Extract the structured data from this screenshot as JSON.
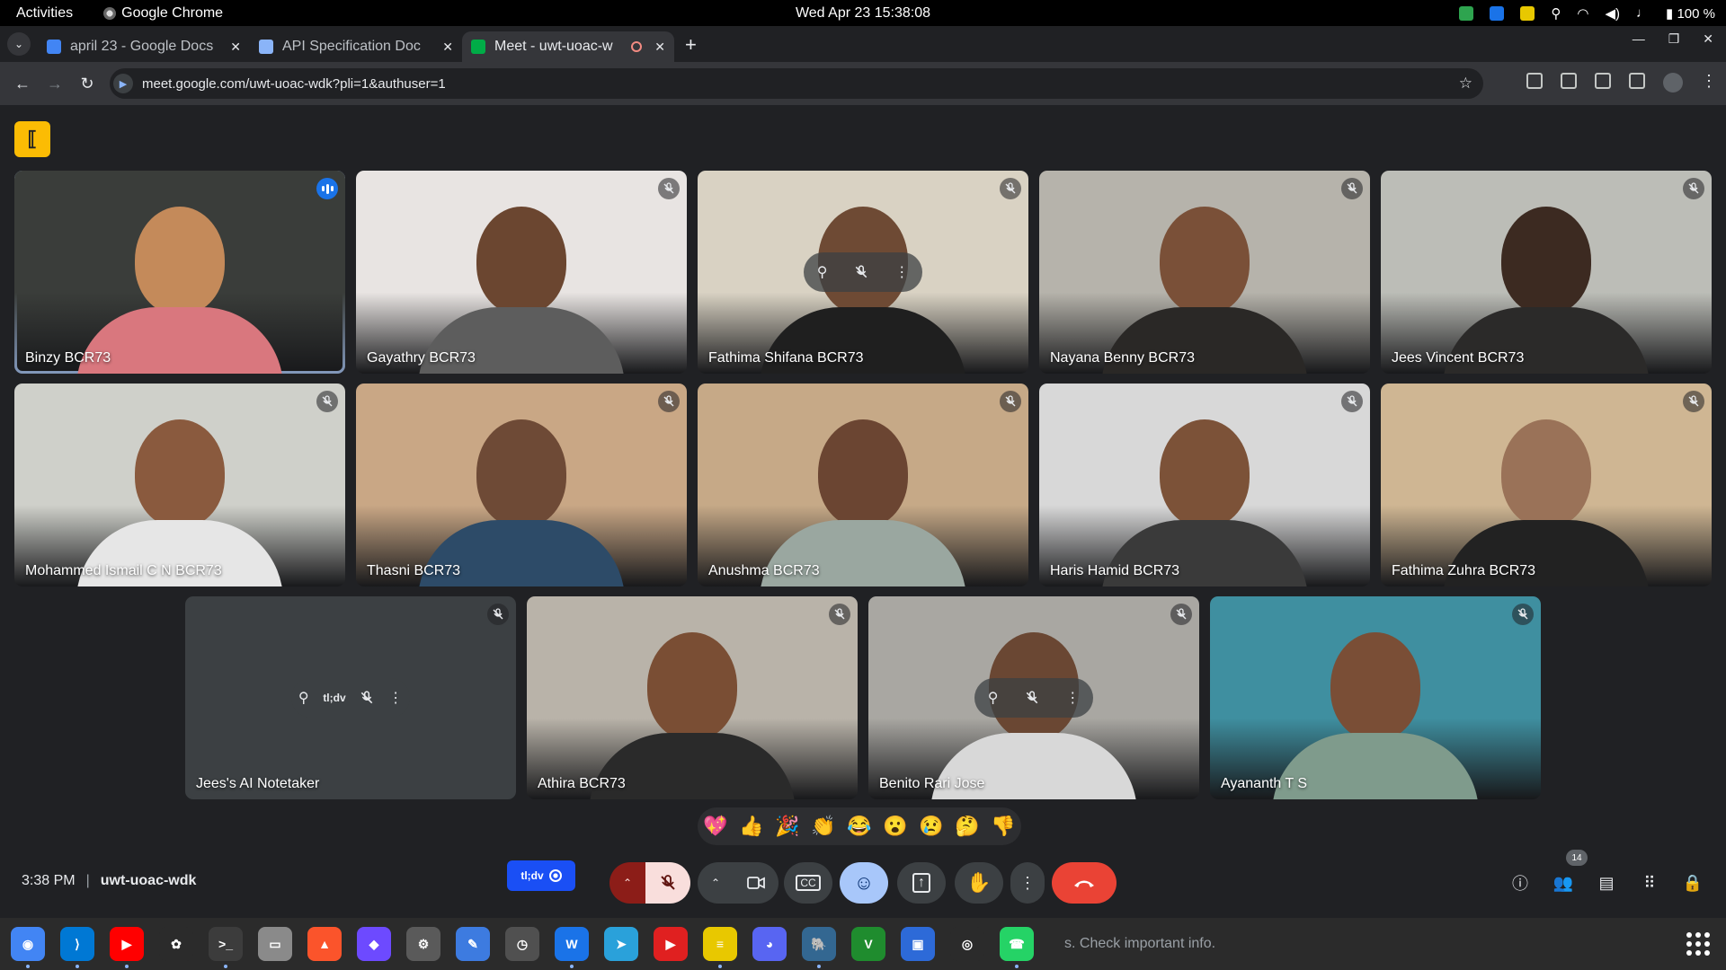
{
  "topbar": {
    "activities": "Activities",
    "app_name": "Google Chrome",
    "datetime": "Wed Apr 23  15:38:08",
    "battery": "100 %"
  },
  "tabs": [
    {
      "title": "april 23 - Google Docs",
      "icon": "google-docs-icon",
      "color": "#4285f4"
    },
    {
      "title": "API Specification Doc",
      "icon": "google-docs-icon",
      "color": "#8ab4f8"
    },
    {
      "title": "Meet - uwt-uoac-w",
      "icon": "google-meet-icon",
      "color": "#00ac47",
      "active": true,
      "recording": true
    }
  ],
  "omnibox": {
    "url": "meet.google.com/uwt-uoac-wdk?pli=1&authuser=1"
  },
  "participants": [
    {
      "name": "Binzy BCR73",
      "speaking": true,
      "bg": "#3a3d3a",
      "skin": "#c48a5a",
      "cloth": "#d9777e"
    },
    {
      "name": "Gayathry BCR73",
      "bg": "#e8e4e2",
      "skin": "#6b4630",
      "cloth": "#5d5d5d"
    },
    {
      "name": "Fathima Shifana BCR73",
      "bg": "#d9d2c3",
      "skin": "#6e4a34",
      "cloth": "#1f1f1f",
      "hovered": true
    },
    {
      "name": "Nayana Benny BCR73",
      "bg": "#b6b3ab",
      "skin": "#7a5038",
      "cloth": "#2a2826"
    },
    {
      "name": "Jees Vincent BCR73",
      "bg": "#bcbdb7",
      "skin": "#3c2a21",
      "cloth": "#2b2a29"
    },
    {
      "name": "Mohammed Ismail C N BCR73",
      "bg": "#cfd0ca",
      "skin": "#8a5a3e",
      "cloth": "#e6e6e6"
    },
    {
      "name": "Thasni BCR73",
      "bg": "#c9a785",
      "skin": "#6e4a36",
      "cloth": "#2d4b68"
    },
    {
      "name": "Anushma BCR73",
      "bg": "#c6a987",
      "skin": "#6b4532",
      "cloth": "#9aa7a0"
    },
    {
      "name": "Haris Hamid BCR73",
      "bg": "#d8d8d8",
      "skin": "#7c5238",
      "cloth": "#3a3a3a"
    },
    {
      "name": "Fathima Zuhra BCR73",
      "bg": "#cfb693",
      "skin": "#9a7258",
      "cloth": "#222222"
    },
    {
      "name": "Jees's AI Notetaker",
      "bg": "#3c4043",
      "bot": true,
      "bot_label": "tl;dv"
    },
    {
      "name": "Athira BCR73",
      "bg": "#b9b3a9",
      "skin": "#7a4e34",
      "cloth": "#2a2a2a"
    },
    {
      "name": "Benito Rari Jose",
      "bg": "#a9a7a2",
      "skin": "#6a4733",
      "cloth": "#d8d8d8",
      "hovered": true
    },
    {
      "name": "Ayananth T S",
      "bg": "#3f8fa0",
      "skin": "#7a4e36",
      "cloth": "#7f9b8c"
    }
  ],
  "reactions": [
    "💖",
    "👍",
    "🎉",
    "👏",
    "😂",
    "😮",
    "😢",
    "🤔",
    "👎"
  ],
  "meeting": {
    "time": "3:38 PM",
    "separator": "|",
    "code": "uwt-uoac-wdk"
  },
  "tldv_badge": "tl;dv",
  "people_count": "14",
  "dock_hint": "s. Check important info.",
  "dock": [
    {
      "name": "chrome-icon",
      "color": "#4285f4",
      "running": true,
      "glyph": "◉"
    },
    {
      "name": "vscode-icon",
      "color": "#0078d4",
      "running": true,
      "glyph": "⟩"
    },
    {
      "name": "youtube-icon",
      "color": "#ff0000",
      "running": true,
      "glyph": "▶"
    },
    {
      "name": "chatgpt-icon",
      "color": "#2b2b2b",
      "running": false,
      "glyph": "✿"
    },
    {
      "name": "terminal-icon",
      "color": "#3c3c3c",
      "running": true,
      "glyph": ">_"
    },
    {
      "name": "files-icon",
      "color": "#8a8a8a",
      "running": false,
      "glyph": "▭"
    },
    {
      "name": "brave-icon",
      "color": "#fb542b",
      "running": false,
      "glyph": "▲"
    },
    {
      "name": "proton-icon",
      "color": "#6d4aff",
      "running": false,
      "glyph": "◆"
    },
    {
      "name": "settings-icon",
      "color": "#5a5a5a",
      "running": false,
      "glyph": "⚙"
    },
    {
      "name": "text-editor-icon",
      "color": "#3d7be0",
      "running": false,
      "glyph": "✎"
    },
    {
      "name": "clock-icon",
      "color": "#505050",
      "running": false,
      "glyph": "◷"
    },
    {
      "name": "writer-icon",
      "color": "#1a73e8",
      "running": true,
      "glyph": "W"
    },
    {
      "name": "telegram-icon",
      "color": "#2aa1da",
      "running": false,
      "glyph": "➤"
    },
    {
      "name": "media-player-icon",
      "color": "#e02020",
      "running": false,
      "glyph": "▶"
    },
    {
      "name": "notes-icon",
      "color": "#e8c800",
      "running": true,
      "glyph": "≡"
    },
    {
      "name": "discord-icon",
      "color": "#5865f2",
      "running": false,
      "glyph": "◕"
    },
    {
      "name": "postgres-icon",
      "color": "#336791",
      "running": true,
      "glyph": "🐘"
    },
    {
      "name": "vim-icon",
      "color": "#1f8c2e",
      "running": false,
      "glyph": "V"
    },
    {
      "name": "remote-desktop-icon",
      "color": "#2d6ad8",
      "running": false,
      "glyph": "▣"
    },
    {
      "name": "obs-icon",
      "color": "#2b2b2b",
      "running": false,
      "glyph": "◎"
    },
    {
      "name": "whatsapp-icon",
      "color": "#25d366",
      "running": true,
      "glyph": "☎"
    }
  ],
  "colors": {
    "end_call": "#ea4335",
    "mic_muted_bg": "#f9dedc",
    "mic_muted_dark": "#8c1d18",
    "emoji_active": "#a8c7fa",
    "tldv": "#1a4ff5"
  }
}
